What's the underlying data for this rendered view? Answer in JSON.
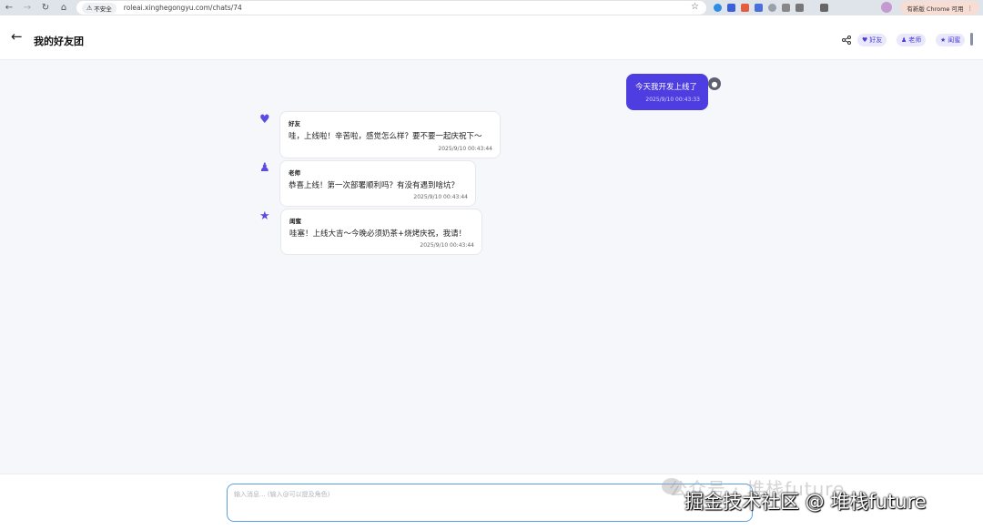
{
  "browser": {
    "insecure_label": "不安全",
    "url": "roleai.xinghegongyu.com/chats/74",
    "update_label": "有新版 Chrome 可用"
  },
  "header": {
    "title": "我的好友团",
    "roles": [
      {
        "label": "好友",
        "icon": "heart-icon"
      },
      {
        "label": "老师",
        "icon": "teacher-icon"
      },
      {
        "label": "闺蜜",
        "icon": "star-icon"
      }
    ]
  },
  "messages": {
    "user": {
      "text": "今天我开发上线了",
      "time": "2025/9/10 00:43:33"
    },
    "replies": [
      {
        "name": "好友",
        "icon": "heart-icon",
        "text": "哇，上线啦！辛苦啦，感觉怎么样？要不要一起庆祝下～",
        "time": "2025/9/10 00:43:44"
      },
      {
        "name": "老师",
        "icon": "teacher-icon",
        "text": "恭喜上线！第一次部署顺利吗？有没有遇到啥坑？",
        "time": "2025/9/10 00:43:44"
      },
      {
        "name": "闺蜜",
        "icon": "star-icon",
        "text": "哇塞！上线大吉～今晚必须奶茶+烧烤庆祝，我请！",
        "time": "2025/9/10 00:43:44"
      }
    ]
  },
  "input": {
    "placeholder": "输入消息... (输入@可以提及角色)"
  },
  "watermark": {
    "ghost": "公众号 · 堆栈future",
    "main": "掘金技术社区 @ 堆栈future"
  },
  "colors": {
    "accent": "#4e3de0",
    "chip_bg": "#e9e9fb"
  }
}
